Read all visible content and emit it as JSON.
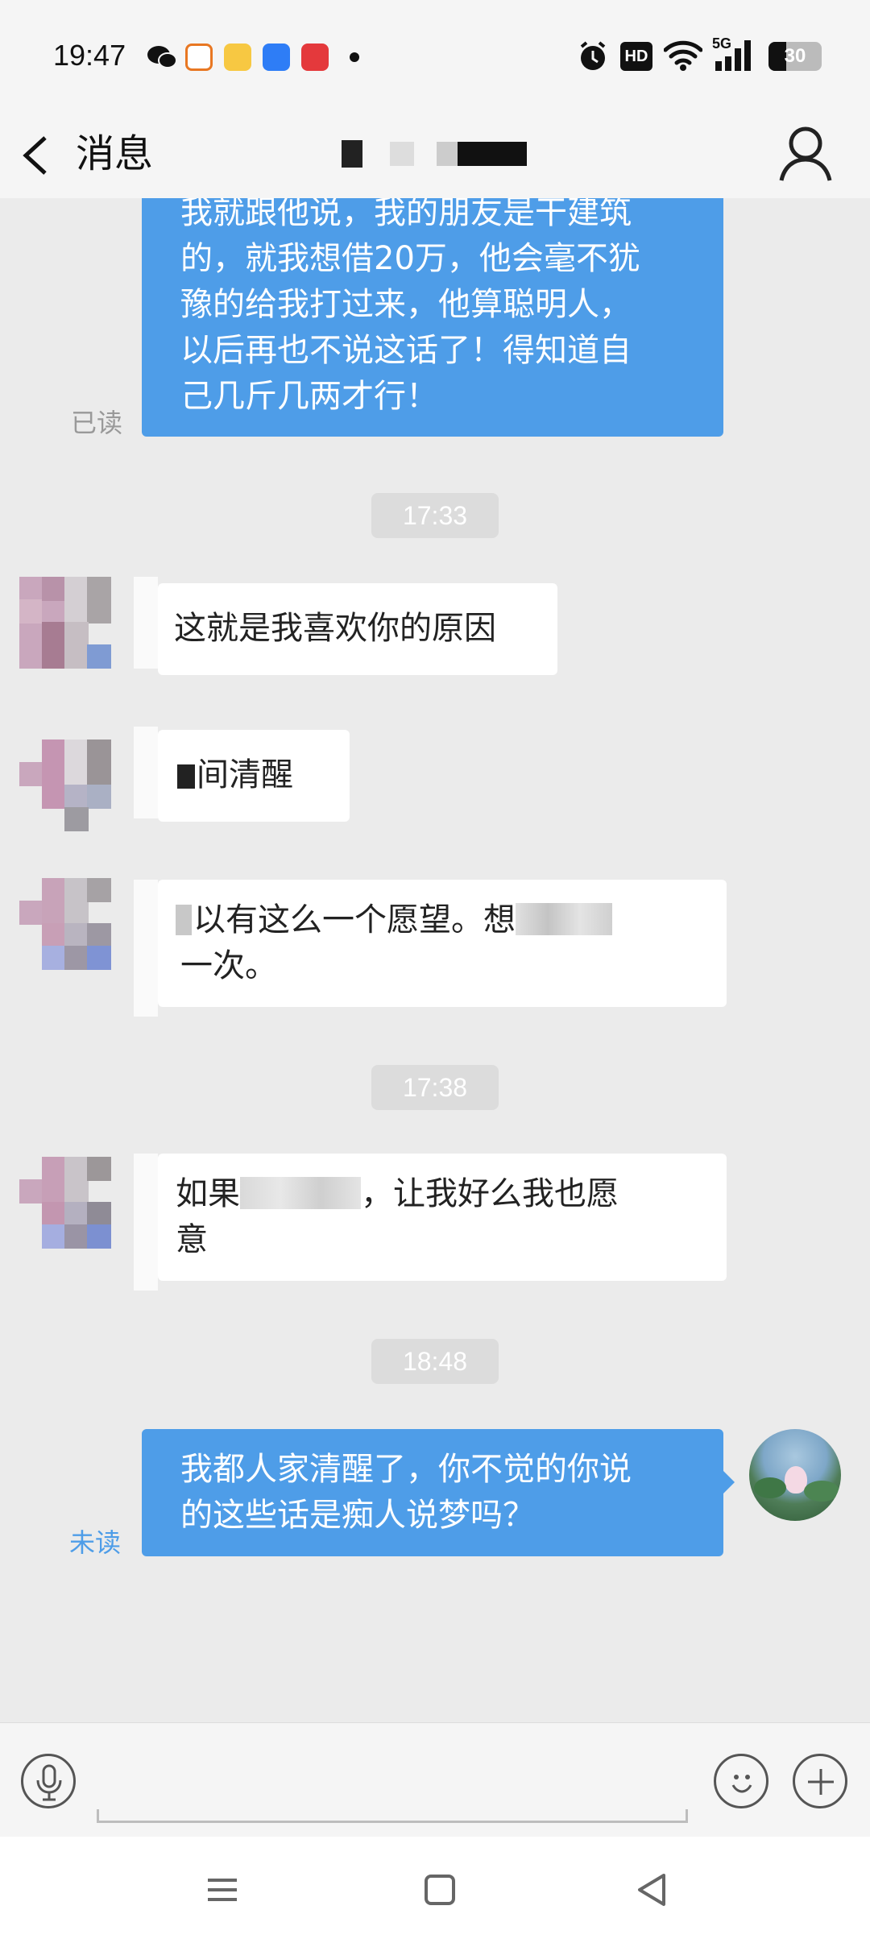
{
  "status_bar": {
    "time": "19:47",
    "signal_label": "5G",
    "hd_label": "HD",
    "battery": "30"
  },
  "nav": {
    "back_label": "消息",
    "icons": [
      "back-chevron-icon",
      "profile-icon"
    ]
  },
  "messages": [
    {
      "type": "out",
      "lines": [
        "我就跟他说，我的朋友是干建筑",
        "的，就我想借20万，他会毫不犹",
        "豫的给我打过来，他算聪明人，",
        "以后再也不说这话了！得知道自",
        "己几斤几两才行！"
      ],
      "receipt": "已读"
    },
    {
      "type": "time",
      "text": "17:33"
    },
    {
      "type": "in",
      "lines": [
        "这就是我喜欢你的原因"
      ]
    },
    {
      "type": "in",
      "lines": [
        "间清醒"
      ]
    },
    {
      "type": "in",
      "lines": [
        "以有这么一个愿望。想",
        "一次。"
      ]
    },
    {
      "type": "time",
      "text": "17:38"
    },
    {
      "type": "in",
      "lines": [
        "如果",
        "，让我好么我也愿",
        "意"
      ]
    },
    {
      "type": "time",
      "text": "18:48"
    },
    {
      "type": "out",
      "lines": [
        "我都人家清醒了，你不觉的你说",
        "的这些话是痴人说梦吗？"
      ],
      "receipt": "未读"
    }
  ],
  "colors": {
    "out_bubble": "#4e9de8",
    "read_receipt": "#999999",
    "unread_receipt": "#4e9de8"
  },
  "input_bar": {
    "icons": [
      "microphone-icon",
      "emoji-icon",
      "plus-icon"
    ]
  },
  "system_nav": {
    "icons": [
      "menu-icon",
      "home-square-icon",
      "back-triangle-icon"
    ]
  }
}
